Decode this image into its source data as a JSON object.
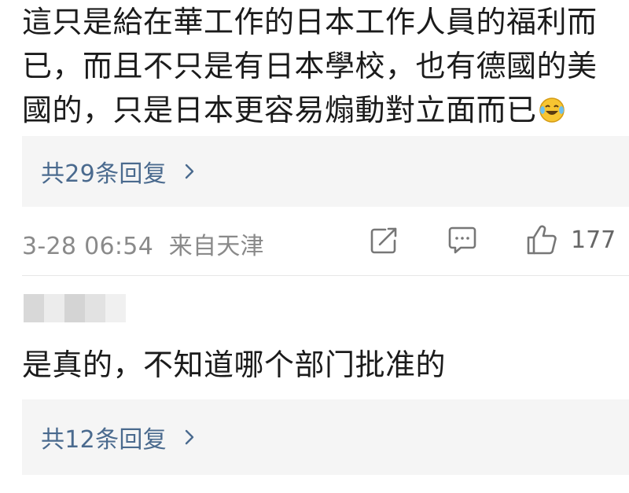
{
  "comment1": {
    "text": "這只是給在華工作的日本工作人員的福利而已，而且不只是有日本學校，也有德國的美國的，只是日本更容易煽動對立面而已",
    "emoji": "laughing-crying-emoji",
    "replies_label": "共29条回复",
    "meta_time": "3-28 06:54  来自天津",
    "like_count": "177"
  },
  "comment2": {
    "username_redacted": true,
    "text": "是真的，不知道哪个部门批准的",
    "replies_label": "共12条回复"
  },
  "colors": {
    "reply_link": "#4a6a8e",
    "reply_bg": "#f5f5f5",
    "meta_text": "#8a8a8a",
    "icon_stroke": "#777777"
  },
  "icons": {
    "share": "share-icon",
    "comment": "comment-icon",
    "like": "thumbs-up-icon",
    "chevron": "chevron-right-icon"
  }
}
